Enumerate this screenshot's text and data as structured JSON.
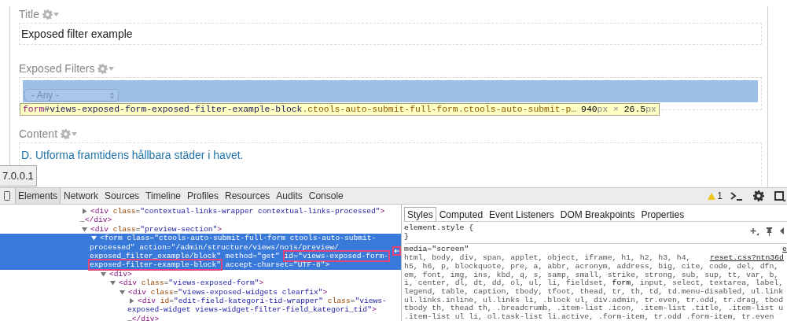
{
  "page": {
    "sections": [
      {
        "kind": "text",
        "heading": "Title",
        "value": "Exposed filter example"
      },
      {
        "kind": "filter",
        "heading": "Exposed Filters",
        "select": {
          "value": "- Any -"
        },
        "highlighted": true,
        "inspect_tooltip": {
          "selector": [
            {
              "text": "form",
              "kind": "tag"
            },
            {
              "text": "#views-exposed-form-exposed-filter-example-block",
              "kind": "id"
            },
            {
              "text": ".ctools-auto-submit-full-form.ctools-auto-submit-p…",
              "kind": "class"
            }
          ],
          "size": [
            {
              "text": "940",
              "kind": "number"
            },
            {
              "text": "px",
              "kind": "unit"
            },
            {
              "text": " × ",
              "kind": "unit"
            },
            {
              "text": "26.5",
              "kind": "number"
            },
            {
              "text": "px",
              "kind": "unit"
            }
          ]
        }
      },
      {
        "kind": "link",
        "heading": "Content",
        "value": "D. Utforma framtidens hållbara städer i havet."
      }
    ],
    "url_tooltip": "7.0.0.1"
  },
  "devtools": {
    "tabs": [
      {
        "label": "Elements",
        "selected": true
      },
      {
        "label": "Network",
        "selected": false
      },
      {
        "label": "Sources",
        "selected": false
      },
      {
        "label": "Timeline",
        "selected": false
      },
      {
        "label": "Profiles",
        "selected": false
      },
      {
        "label": "Resources",
        "selected": false
      },
      {
        "label": "Audits",
        "selected": false
      },
      {
        "label": "Console",
        "selected": false
      }
    ],
    "warning_count": "1",
    "dom_tree": [
      {
        "expanded": false,
        "selected": false,
        "lines": [
          [
            {
              "text": "<div class=\"contextual-links-wrapper contextual-links-processed\">",
              "boxed": false
            }
          ],
          [
            {
              "text": "…</div>",
              "boxed": false
            }
          ]
        ]
      },
      {
        "expanded": true,
        "selected": false,
        "lines": [
          [
            {
              "text": "<div class=\"preview-section\">",
              "boxed": false
            }
          ]
        ],
        "children": [
          {
            "expanded": true,
            "selected": true,
            "lines": [
              [
                {
                  "text": "<form class=\"ctools-auto-submit-full-form ctools-auto-submit-",
                  "boxed": false
                }
              ],
              [
                {
                  "text": "processed\" action=\"/admin/structure/views/nojs/preview/",
                  "boxed": false
                }
              ],
              [
                {
                  "text": "exposed_filter_example/block\" method=\"get\" ",
                  "boxed": false
                },
                {
                  "text": "id=\"views-exposed-form-",
                  "boxed": true
                }
              ],
              [
                {
                  "text": "exposed-filter-example-block\"",
                  "boxed": true
                },
                {
                  "text": " accept-charset=\"UTF-8\">",
                  "boxed": false
                }
              ]
            ],
            "children": [
              {
                "expanded": true,
                "selected": false,
                "lines": [
                  [
                    {
                      "text": "<div>",
                      "boxed": false
                    }
                  ]
                ],
                "children": [
                  {
                    "expanded": true,
                    "selected": false,
                    "lines": [
                      [
                        {
                          "text": "<div class=\"views-exposed-form\">",
                          "boxed": false
                        }
                      ]
                    ],
                    "children": [
                      {
                        "expanded": true,
                        "selected": false,
                        "lines": [
                          [
                            {
                              "text": "<div class=\"views-exposed-widgets clearfix\">",
                              "boxed": false
                            }
                          ]
                        ],
                        "children": [
                          {
                            "expanded": false,
                            "selected": false,
                            "lines": [
                              [
                                {
                                  "text": "<div id=\"edit-field-kategori-tid-wrapper\" class=\"views-",
                                  "boxed": false
                                }
                              ],
                              [
                                {
                                  "text": "exposed-widget views-widget-filter-field_kategori_tid\">",
                                  "boxed": false
                                }
                              ],
                              [
                                {
                                  "text": "…</div>",
                                  "boxed": false
                                }
                              ]
                            ]
                          }
                        ]
                      }
                    ]
                  }
                ]
              }
            ]
          }
        ]
      }
    ],
    "styles": {
      "tabs": [
        {
          "label": "Styles",
          "selected": true
        },
        {
          "label": "Computed",
          "selected": false
        },
        {
          "label": "Event Listeners",
          "selected": false
        },
        {
          "label": "DOM Breakpoints",
          "selected": false
        },
        {
          "label": "Properties",
          "selected": false
        }
      ],
      "element_style": [
        "element.style {",
        "}"
      ],
      "rule": {
        "media": "media=\"screen\"",
        "source_cut": "e",
        "source": "reset.css?ntn36d",
        "lines": [
          [
            {
              "text": "html, body, div, span, applet, object, iframe, h1, h2, h3, h4,",
              "matched": false
            }
          ],
          [
            {
              "text": "h5, h6, p, blockquote, pre, a, abbr, acronym, address, big, cite, code, del, dfn,",
              "matched": false
            }
          ],
          [
            {
              "text": "em, font, img, ins, kbd, q, s, samp, small, strike, strong, sub, sup, tt, var, b,",
              "matched": false
            }
          ],
          [
            {
              "text": "i, center, dl, dt, dd, ol, ul, li, fieldset, ",
              "matched": false
            },
            {
              "text": "form",
              "matched": true
            },
            {
              "text": ", input, select, textarea, label,",
              "matched": false
            }
          ],
          [
            {
              "text": "legend, table, caption, tbody, tfoot, thead, tr, th, td, td.menu-disabled, ul.link",
              "matched": false
            }
          ],
          [
            {
              "text": "ul.links.inline, ul.links li, .block ul, div.admin, tr.even, tr.odd, tr.drag, tbod",
              "matched": false
            }
          ],
          [
            {
              "text": "tbody th, thead th, .breadcrumb, .item-list .icon, .item-list .title, .item-list u",
              "matched": false
            }
          ],
          [
            {
              "text": ".item-list ul li, ol.task-list li.active, .form-item, tr.odd .form-item, tr.even",
              "matched": false
            }
          ]
        ]
      }
    }
  }
}
